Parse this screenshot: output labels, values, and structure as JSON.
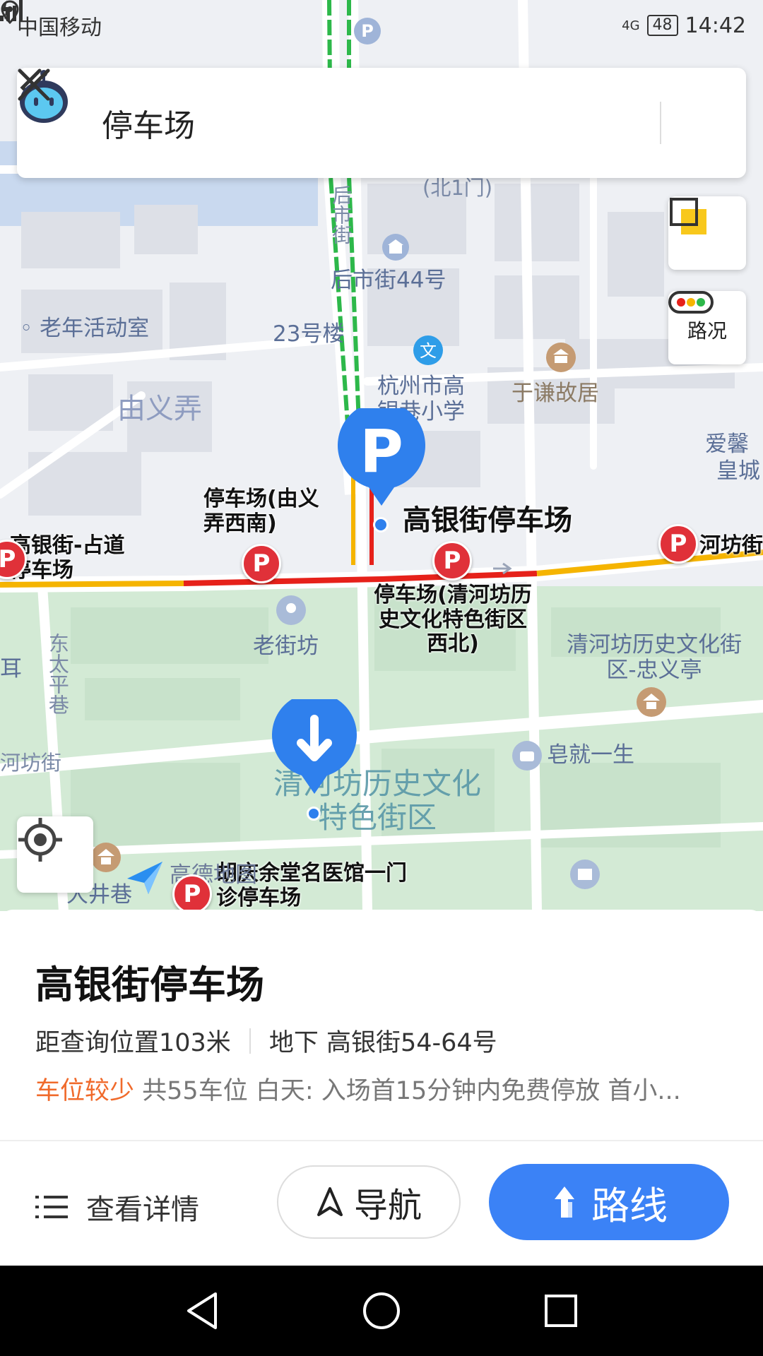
{
  "status_bar": {
    "carrier": "中国移动",
    "network": "4G",
    "battery": "48",
    "time": "14:42"
  },
  "search": {
    "query": "停车场"
  },
  "map": {
    "traffic_label": "路况",
    "labels": {
      "beiyimen": "(北1门)",
      "houshijie_road": "后市街",
      "houshijie44": "后市街44号",
      "laonian": "老年活动室",
      "building23": "23号楼",
      "school": "杭州市高银巷小学",
      "yuqian": "于谦故居",
      "youyinong": "由义弄",
      "aixin": "爱馨",
      "huangcheng": "皇城",
      "gaoyinjie_zhandao": "高银街-占道停车场",
      "pk_youyi": "停车场(由义弄西南)",
      "hefang": "河坊街",
      "laojiefang": "老街坊",
      "pk_qinghe": "停车场(清河坊历史文化特色街区西北)",
      "qinghefang_zhongyi": "清河坊历史文化街区-忠义亭",
      "dongtaiping": "东太平巷",
      "hefangjie_left": "河坊街",
      "zaojiu": "皂就一生",
      "qinghefang_area": "清河坊历史文化特色街区",
      "dajingxiang": "大井巷",
      "hutang": "胡庆余堂名医馆一门诊停车场",
      "gaode": "高德地图",
      "er": "耳"
    },
    "selected": {
      "name": "高银街停车场"
    }
  },
  "sheet": {
    "title": "高银街停车场",
    "distance": "距查询位置103米",
    "address": "地下 高银街54-64号",
    "status": "车位较少",
    "info": "共55车位 白天: 入场首15分钟内免费停放 首小...",
    "details_label": "查看详情",
    "navigate_label": "导航",
    "route_label": "路线"
  },
  "colors": {
    "accent": "#3b82f6",
    "parking_red": "#e03139",
    "warning": "#f06a2b"
  }
}
